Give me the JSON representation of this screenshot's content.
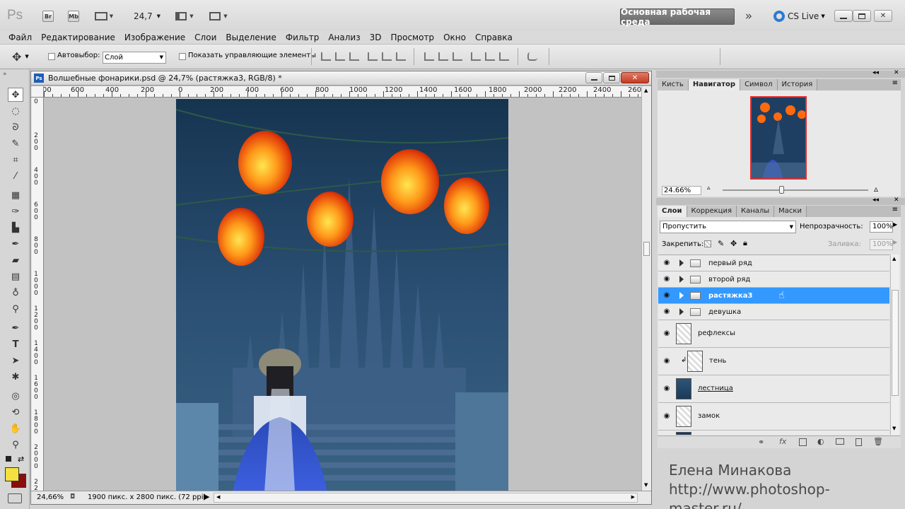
{
  "app": {
    "logo": "Ps",
    "bridge": "Br",
    "minibridge": "Mb",
    "zoom_value": "24,7",
    "workspace_button": "Основная рабочая среда",
    "cslive": "CS Live"
  },
  "menu": [
    "Файл",
    "Редактирование",
    "Изображение",
    "Слои",
    "Выделение",
    "Фильтр",
    "Анализ",
    "3D",
    "Просмотр",
    "Окно",
    "Справка"
  ],
  "options": {
    "autoselect_label": "Автовыбор:",
    "autoselect_value": "Слой",
    "show_controls_label": "Показать управляющие элементы"
  },
  "document": {
    "title": "Волшебные фонарики.psd @ 24,7% (растяжка3, RGB/8) *",
    "ruler_h": [
      "00",
      "600",
      "400",
      "200",
      "0",
      "200",
      "400",
      "600",
      "800",
      "1000",
      "1200",
      "1400",
      "1600",
      "1800",
      "2000",
      "2200",
      "2400",
      "260"
    ],
    "ruler_v": [
      "0",
      "2 0 0",
      "4 0 0",
      "6 0 0",
      "8 0 0",
      "1 0 0 0",
      "1 2 0 0",
      "1 4 0 0",
      "1 6 0 0",
      "1 8 0 0",
      "2 0 0 0",
      "2 2 0 0"
    ],
    "status_zoom": "24,66%",
    "status_info": "1900 пикс. x 2800 пикс. (72 ppi)"
  },
  "navigator": {
    "tabs": [
      "Кисть",
      "Навигатор",
      "Символ",
      "История"
    ],
    "active_tab": "Навигатор",
    "zoom": "24.66%"
  },
  "layers_panel": {
    "tabs": [
      "Слои",
      "Коррекция",
      "Каналы",
      "Маски"
    ],
    "active_tab": "Слои",
    "blend_mode": "Пропустить",
    "opacity_label": "Непрозрачность:",
    "opacity_value": "100%",
    "lock_label": "Закрепить:",
    "fill_label": "Заливка:",
    "fill_value": "100%",
    "layers": [
      {
        "name": "первый ряд",
        "type": "group",
        "selected": false
      },
      {
        "name": "второй ряд",
        "type": "group",
        "selected": false
      },
      {
        "name": "растяжка3",
        "type": "group",
        "selected": true
      },
      {
        "name": "девушка",
        "type": "group",
        "selected": false
      },
      {
        "name": "рефлексы",
        "type": "layer",
        "selected": false
      },
      {
        "name": "тень",
        "type": "layer",
        "clipped": true,
        "selected": false
      },
      {
        "name": "лестница",
        "type": "layer",
        "selected": false
      },
      {
        "name": "замок",
        "type": "layer",
        "selected": false
      }
    ]
  },
  "watermark": {
    "line1": "Елена Минакова",
    "line2": "http://www.photoshop-master.ru/"
  },
  "colors": {
    "selection": "#3399ff",
    "foreground": "#f4e040",
    "background": "#8a0d0d"
  }
}
